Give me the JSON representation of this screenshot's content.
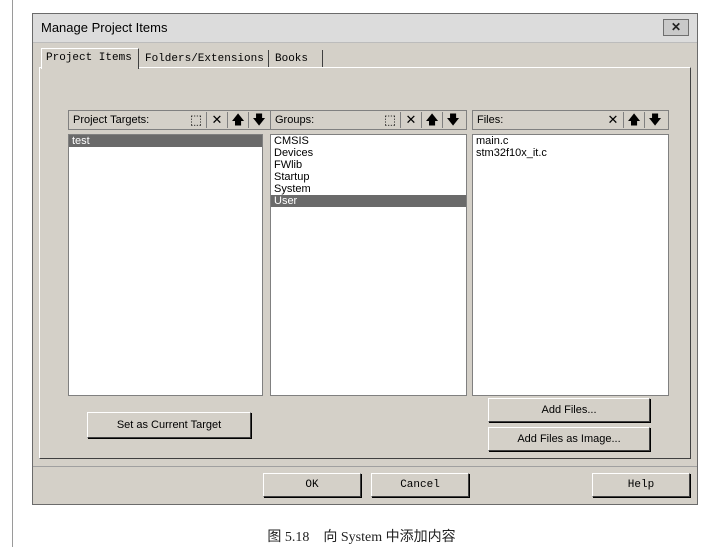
{
  "window": {
    "title": "Manage Project Items",
    "close_label": "✕"
  },
  "tabs": [
    "Project Items",
    "Folders/Extensions",
    "Books"
  ],
  "targets": {
    "label": "Project Targets:",
    "items": [
      "test"
    ],
    "selected": 0
  },
  "groups": {
    "label": "Groups:",
    "items": [
      "CMSIS",
      "Devices",
      "FWlib",
      "Startup",
      "System",
      "User"
    ],
    "selected": 5
  },
  "files": {
    "label": "Files:",
    "items": [
      "main.c",
      "stm32f10x_it.c"
    ]
  },
  "icons": {
    "new": "⬚",
    "delete": "✕",
    "up": "🡅",
    "down": "🡇"
  },
  "buttons": {
    "set_target": "Set as Current Target",
    "add_files": "Add Files...",
    "add_image": "Add Files as Image...",
    "ok": "OK",
    "cancel": "Cancel",
    "help": "Help"
  },
  "caption": "图 5.18　向 System 中添加内容"
}
